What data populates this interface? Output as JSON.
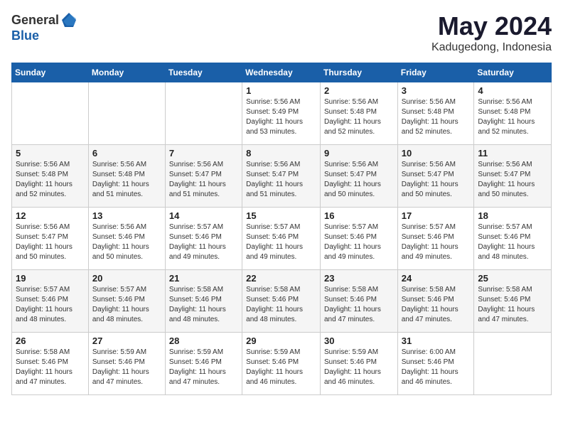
{
  "header": {
    "logo_general": "General",
    "logo_blue": "Blue",
    "month_title": "May 2024",
    "subtitle": "Kadugedong, Indonesia"
  },
  "weekdays": [
    "Sunday",
    "Monday",
    "Tuesday",
    "Wednesday",
    "Thursday",
    "Friday",
    "Saturday"
  ],
  "weeks": [
    [
      {
        "day": "",
        "info": ""
      },
      {
        "day": "",
        "info": ""
      },
      {
        "day": "",
        "info": ""
      },
      {
        "day": "1",
        "info": "Sunrise: 5:56 AM\nSunset: 5:49 PM\nDaylight: 11 hours\nand 53 minutes."
      },
      {
        "day": "2",
        "info": "Sunrise: 5:56 AM\nSunset: 5:48 PM\nDaylight: 11 hours\nand 52 minutes."
      },
      {
        "day": "3",
        "info": "Sunrise: 5:56 AM\nSunset: 5:48 PM\nDaylight: 11 hours\nand 52 minutes."
      },
      {
        "day": "4",
        "info": "Sunrise: 5:56 AM\nSunset: 5:48 PM\nDaylight: 11 hours\nand 52 minutes."
      }
    ],
    [
      {
        "day": "5",
        "info": "Sunrise: 5:56 AM\nSunset: 5:48 PM\nDaylight: 11 hours\nand 52 minutes."
      },
      {
        "day": "6",
        "info": "Sunrise: 5:56 AM\nSunset: 5:48 PM\nDaylight: 11 hours\nand 51 minutes."
      },
      {
        "day": "7",
        "info": "Sunrise: 5:56 AM\nSunset: 5:47 PM\nDaylight: 11 hours\nand 51 minutes."
      },
      {
        "day": "8",
        "info": "Sunrise: 5:56 AM\nSunset: 5:47 PM\nDaylight: 11 hours\nand 51 minutes."
      },
      {
        "day": "9",
        "info": "Sunrise: 5:56 AM\nSunset: 5:47 PM\nDaylight: 11 hours\nand 50 minutes."
      },
      {
        "day": "10",
        "info": "Sunrise: 5:56 AM\nSunset: 5:47 PM\nDaylight: 11 hours\nand 50 minutes."
      },
      {
        "day": "11",
        "info": "Sunrise: 5:56 AM\nSunset: 5:47 PM\nDaylight: 11 hours\nand 50 minutes."
      }
    ],
    [
      {
        "day": "12",
        "info": "Sunrise: 5:56 AM\nSunset: 5:47 PM\nDaylight: 11 hours\nand 50 minutes."
      },
      {
        "day": "13",
        "info": "Sunrise: 5:56 AM\nSunset: 5:46 PM\nDaylight: 11 hours\nand 50 minutes."
      },
      {
        "day": "14",
        "info": "Sunrise: 5:57 AM\nSunset: 5:46 PM\nDaylight: 11 hours\nand 49 minutes."
      },
      {
        "day": "15",
        "info": "Sunrise: 5:57 AM\nSunset: 5:46 PM\nDaylight: 11 hours\nand 49 minutes."
      },
      {
        "day": "16",
        "info": "Sunrise: 5:57 AM\nSunset: 5:46 PM\nDaylight: 11 hours\nand 49 minutes."
      },
      {
        "day": "17",
        "info": "Sunrise: 5:57 AM\nSunset: 5:46 PM\nDaylight: 11 hours\nand 49 minutes."
      },
      {
        "day": "18",
        "info": "Sunrise: 5:57 AM\nSunset: 5:46 PM\nDaylight: 11 hours\nand 48 minutes."
      }
    ],
    [
      {
        "day": "19",
        "info": "Sunrise: 5:57 AM\nSunset: 5:46 PM\nDaylight: 11 hours\nand 48 minutes."
      },
      {
        "day": "20",
        "info": "Sunrise: 5:57 AM\nSunset: 5:46 PM\nDaylight: 11 hours\nand 48 minutes."
      },
      {
        "day": "21",
        "info": "Sunrise: 5:58 AM\nSunset: 5:46 PM\nDaylight: 11 hours\nand 48 minutes."
      },
      {
        "day": "22",
        "info": "Sunrise: 5:58 AM\nSunset: 5:46 PM\nDaylight: 11 hours\nand 48 minutes."
      },
      {
        "day": "23",
        "info": "Sunrise: 5:58 AM\nSunset: 5:46 PM\nDaylight: 11 hours\nand 47 minutes."
      },
      {
        "day": "24",
        "info": "Sunrise: 5:58 AM\nSunset: 5:46 PM\nDaylight: 11 hours\nand 47 minutes."
      },
      {
        "day": "25",
        "info": "Sunrise: 5:58 AM\nSunset: 5:46 PM\nDaylight: 11 hours\nand 47 minutes."
      }
    ],
    [
      {
        "day": "26",
        "info": "Sunrise: 5:58 AM\nSunset: 5:46 PM\nDaylight: 11 hours\nand 47 minutes."
      },
      {
        "day": "27",
        "info": "Sunrise: 5:59 AM\nSunset: 5:46 PM\nDaylight: 11 hours\nand 47 minutes."
      },
      {
        "day": "28",
        "info": "Sunrise: 5:59 AM\nSunset: 5:46 PM\nDaylight: 11 hours\nand 47 minutes."
      },
      {
        "day": "29",
        "info": "Sunrise: 5:59 AM\nSunset: 5:46 PM\nDaylight: 11 hours\nand 46 minutes."
      },
      {
        "day": "30",
        "info": "Sunrise: 5:59 AM\nSunset: 5:46 PM\nDaylight: 11 hours\nand 46 minutes."
      },
      {
        "day": "31",
        "info": "Sunrise: 6:00 AM\nSunset: 5:46 PM\nDaylight: 11 hours\nand 46 minutes."
      },
      {
        "day": "",
        "info": ""
      }
    ]
  ]
}
